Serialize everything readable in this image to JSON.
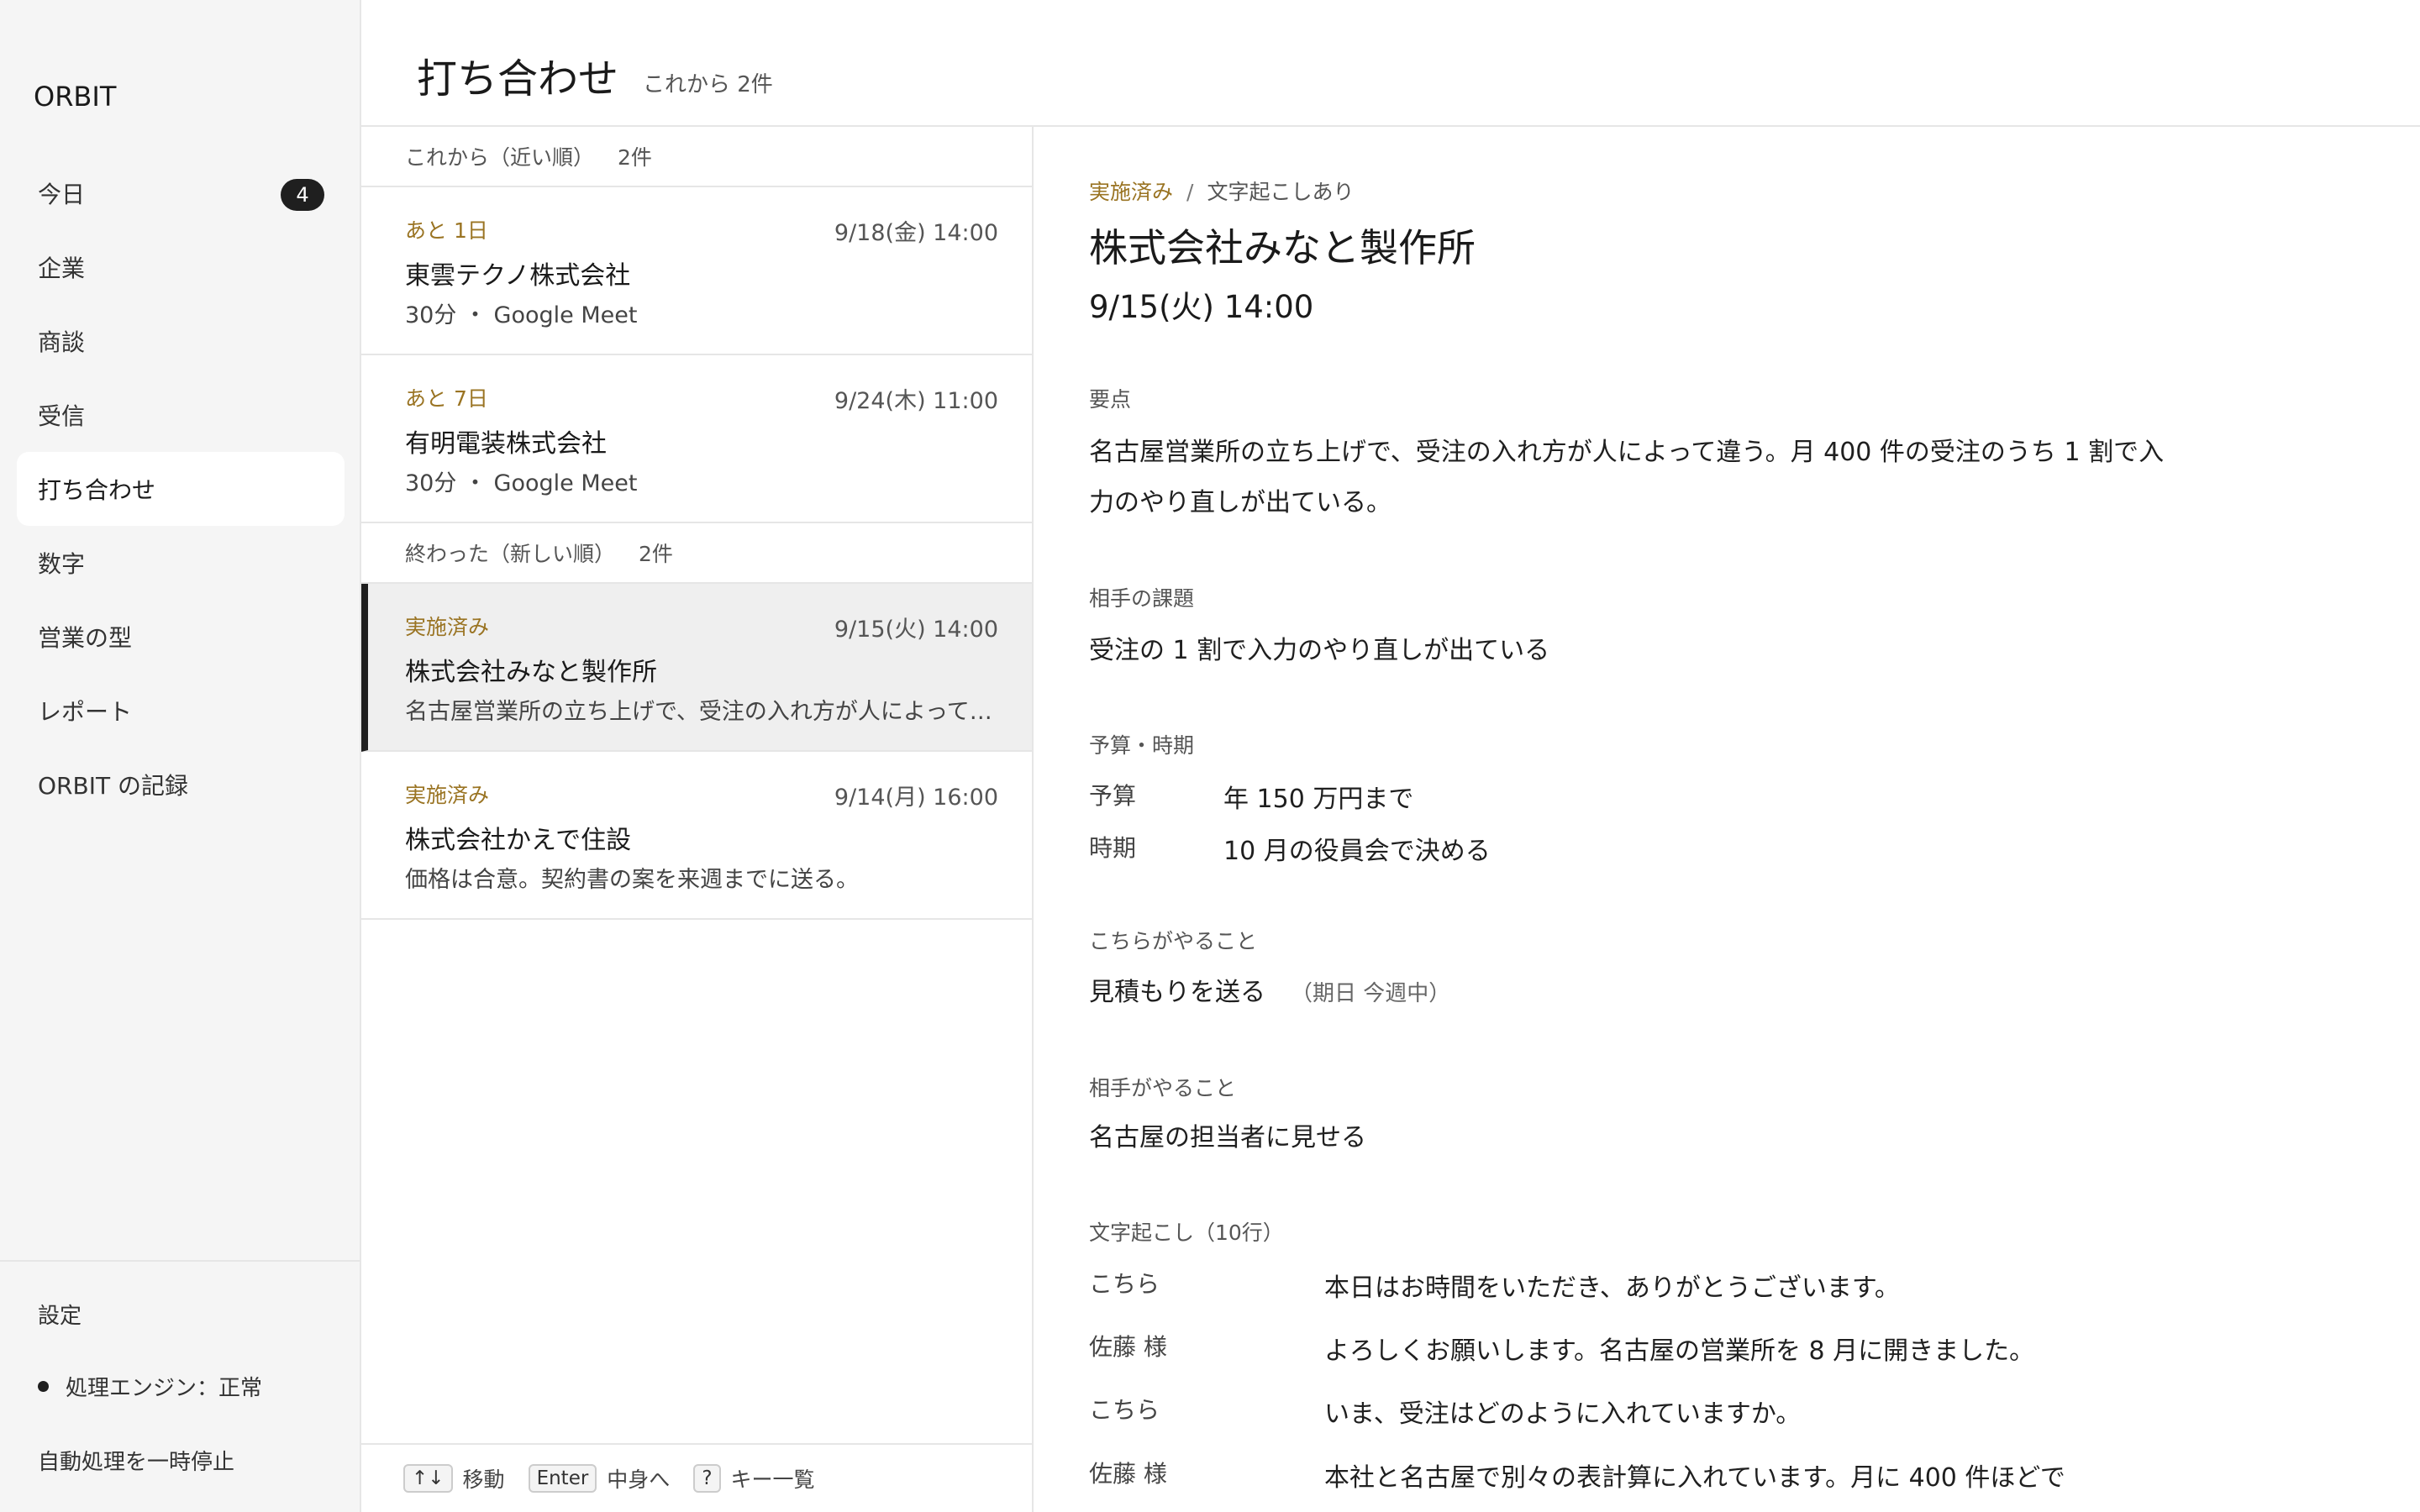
{
  "app": {
    "name": "ORBIT"
  },
  "sidebar": {
    "items": [
      {
        "label": "今日",
        "badge": "4"
      },
      {
        "label": "企業"
      },
      {
        "label": "商談"
      },
      {
        "label": "受信"
      },
      {
        "label": "打ち合わせ",
        "active": true
      },
      {
        "label": "数字"
      },
      {
        "label": "営業の型"
      },
      {
        "label": "レポート"
      },
      {
        "label": "ORBIT の記録"
      }
    ],
    "settings": "設定",
    "engine_status": "処理エンジン：正常",
    "pause": "自動処理を一時停止"
  },
  "header": {
    "title": "打ち合わせ",
    "subtitle": "これから 2件"
  },
  "list": {
    "upcoming_header": "これから（近い順）",
    "upcoming_count": "2件",
    "upcoming": [
      {
        "status": "あと 1日",
        "date": "9/18(金) 14:00",
        "company": "東雲テクノ株式会社",
        "meta": "30分 ・ Google Meet"
      },
      {
        "status": "あと 7日",
        "date": "9/24(木) 11:00",
        "company": "有明電装株式会社",
        "meta": "30分 ・ Google Meet"
      }
    ],
    "past_header": "終わった（新しい順）",
    "past_count": "2件",
    "past": [
      {
        "status": "実施済み",
        "date": "9/15(火) 14:00",
        "company": "株式会社みなと製作所",
        "meta": "名古屋営業所の立ち上げで、受注の入れ方が人によって違う。",
        "selected": true
      },
      {
        "status": "実施済み",
        "date": "9/14(月) 16:00",
        "company": "株式会社かえで住設",
        "meta": "価格は合意。契約書の案を来週までに送る。"
      }
    ],
    "footer": {
      "move_key": "↑↓",
      "move_label": "移動",
      "enter_key": "Enter",
      "enter_label": "中身へ",
      "help_key": "?",
      "help_label": "キー一覧"
    }
  },
  "detail": {
    "status": "実施済み",
    "transcript_flag": "文字起こしあり",
    "company": "株式会社みなと製作所",
    "datetime": "9/15(火) 14:00",
    "summary_label": "要点",
    "summary": "名古屋営業所の立ち上げで、受注の入れ方が人によって違う。月 400 件の受注のうち 1 割で入力のやり直しが出ている。",
    "issue_label": "相手の課題",
    "issue": "受注の 1 割で入力のやり直しが出ている",
    "budget_label": "予算・時期",
    "budget_key": "予算",
    "budget_value": "年 150 万円まで",
    "timing_key": "時期",
    "timing_value": "10 月の役員会で決める",
    "our_todo_label": "こちらがやること",
    "our_todo": "見積もりを送る",
    "our_todo_due": "（期日 今週中）",
    "their_todo_label": "相手がやること",
    "their_todo": "名古屋の担当者に見せる",
    "transcript_label": "文字起こし（10行）",
    "transcript": [
      {
        "speaker": "こちら",
        "text": "本日はお時間をいただき、ありがとうございます。"
      },
      {
        "speaker": "佐藤 様",
        "text": "よろしくお願いします。名古屋の営業所を 8 月に開きました。"
      },
      {
        "speaker": "こちら",
        "text": "いま、受注はどのように入れていますか。"
      },
      {
        "speaker": "佐藤 様",
        "text": "本社と名古屋で別々の表計算に入れています。月に 400 件ほどで"
      }
    ]
  }
}
